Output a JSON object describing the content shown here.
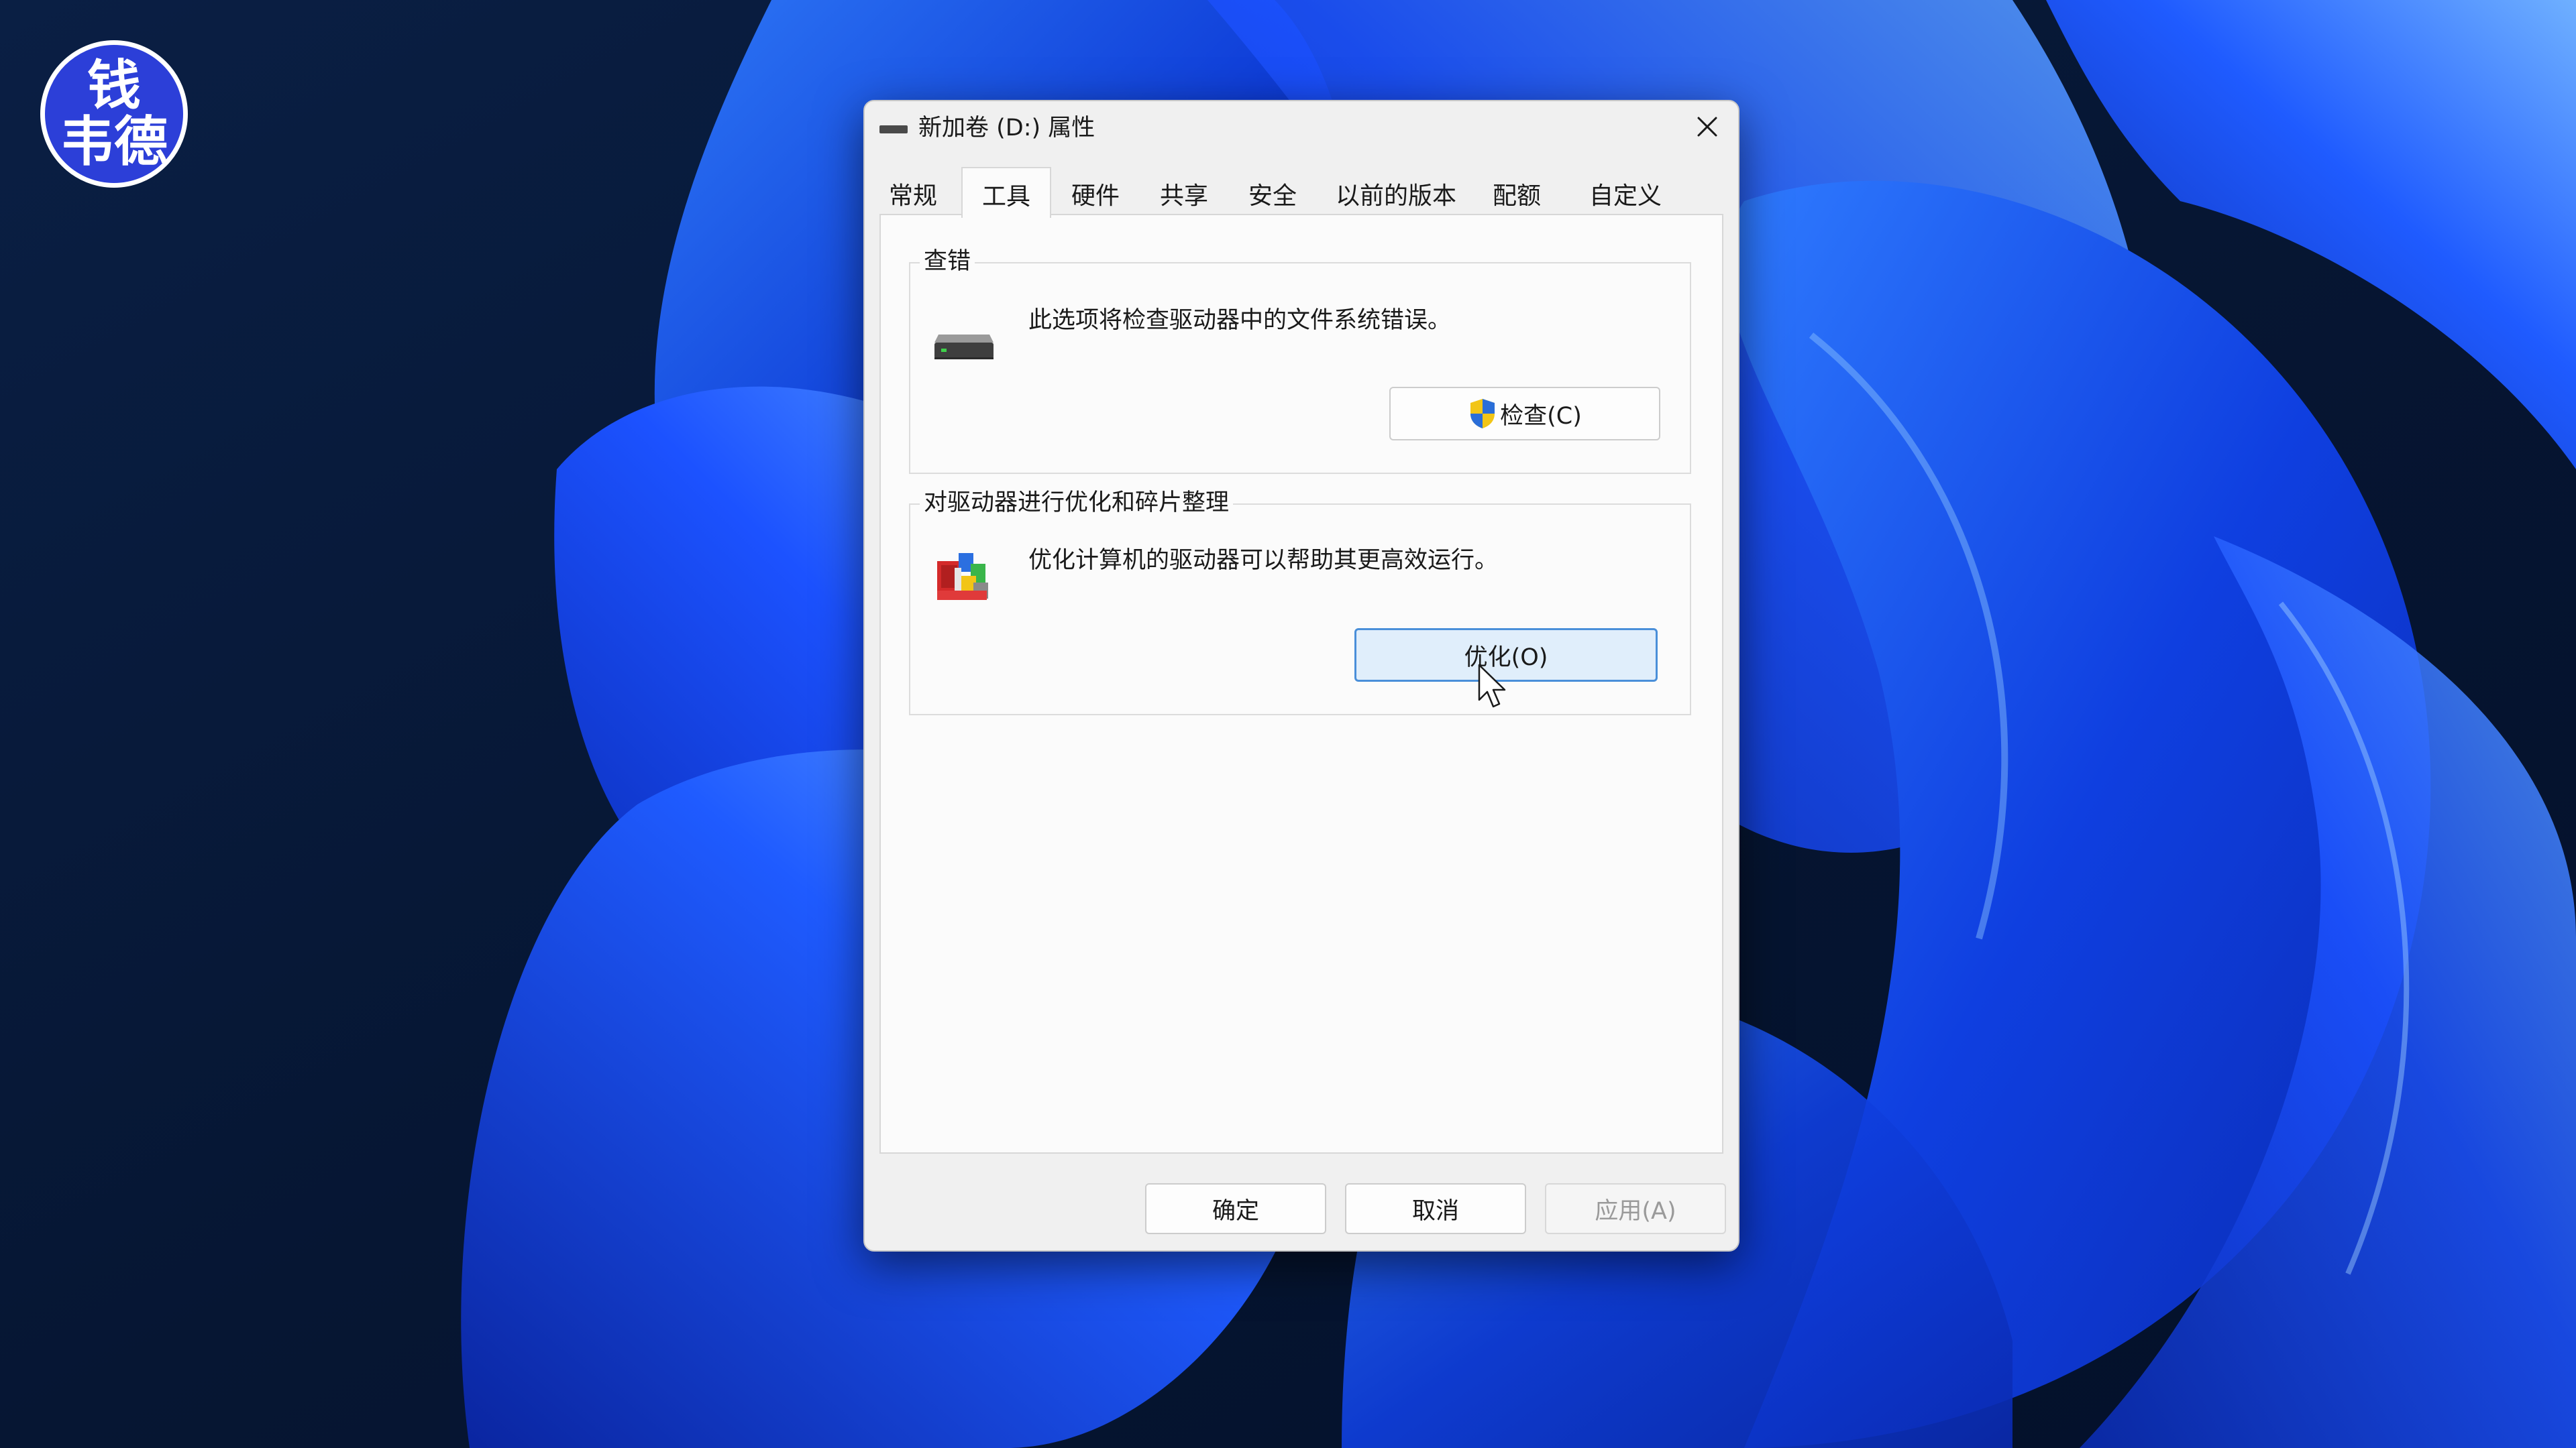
{
  "watermark": {
    "line1": "钱",
    "line2": "韦德"
  },
  "dialog": {
    "title": "新加卷 (D:) 属性",
    "tabs": [
      {
        "label": "常规"
      },
      {
        "label": "工具"
      },
      {
        "label": "硬件"
      },
      {
        "label": "共享"
      },
      {
        "label": "安全"
      },
      {
        "label": "以前的版本"
      },
      {
        "label": "配额"
      },
      {
        "label": "自定义"
      }
    ],
    "active_tab": "工具",
    "error_check": {
      "legend": "查错",
      "description": "此选项将检查驱动器中的文件系统错误。",
      "button_label": "检查(C)"
    },
    "optimize": {
      "legend": "对驱动器进行优化和碎片整理",
      "description": "优化计算机的驱动器可以帮助其更高效运行。",
      "button_label": "优化(O)"
    },
    "footer": {
      "ok_label": "确定",
      "cancel_label": "取消",
      "apply_label": "应用(A)"
    }
  },
  "colors": {
    "accent_blue": "#4a8fd9",
    "wallpaper_dark": "#061633",
    "wallpaper_blue": "#1a4dff",
    "logo_blue": "#2c3fd8"
  },
  "icons": {
    "title": "drive-icon",
    "close": "close-icon",
    "check_section": "hard-drive-icon",
    "optimize_section": "defrag-icon",
    "check_button": "uac-shield-icon",
    "pointer": "mouse-pointer-icon"
  }
}
